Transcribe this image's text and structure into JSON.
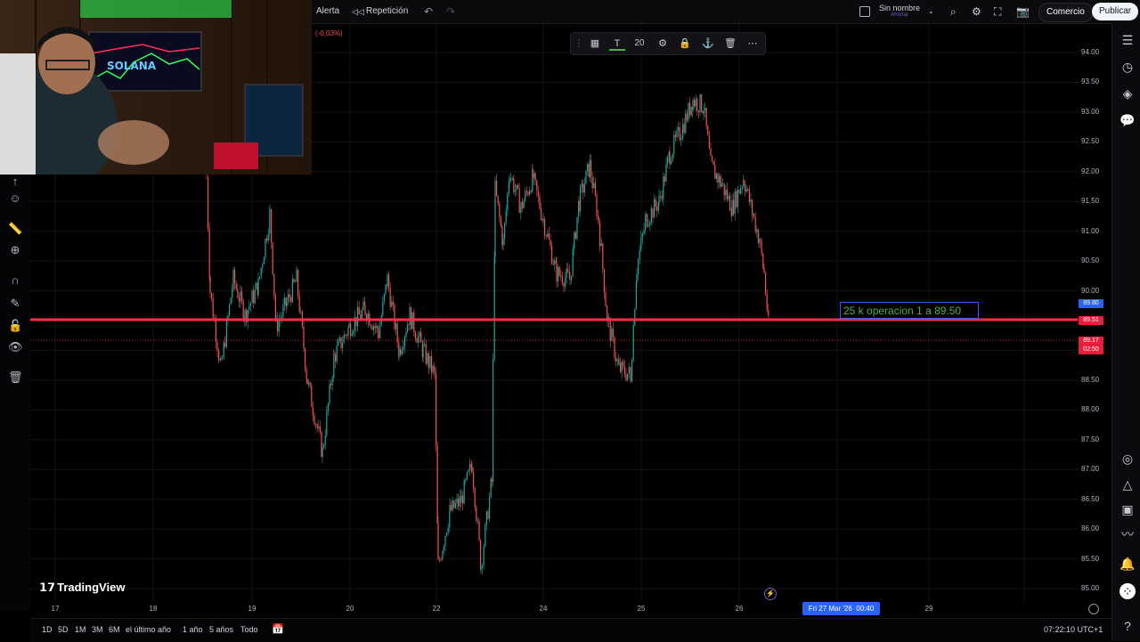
{
  "topbar": {
    "alert_label": "Alerta",
    "replay_label": "Repetición",
    "layout_name": "Sin nombre",
    "layout_status": "Ahorrar",
    "trade_label": "Comercio",
    "publish_label": "Publicar"
  },
  "chart": {
    "change_label": "(-0,03%)",
    "price_ticks": [
      "94.00",
      "93.50",
      "93.00",
      "92.50",
      "92.00",
      "91.50",
      "91.00",
      "90.50",
      "90.00",
      "89.50",
      "89.00",
      "88.50",
      "88.00",
      "87.50",
      "87.00",
      "86.50",
      "86.00",
      "85.50",
      "85.00"
    ],
    "time_ticks": [
      "17",
      "18",
      "19",
      "20",
      "22",
      "24",
      "25",
      "26",
      "29"
    ],
    "labels": {
      "blue": "89.80",
      "red_line": "89.51",
      "last_price": "89.17",
      "countdown": "02:50"
    },
    "annotation": "25 k operacion 1 a 89.50",
    "crosshair_date": "Fri 27 Mar '26",
    "crosshair_time": "00:40",
    "logo_text": "TradingView",
    "colors": {
      "up": "#26a69a",
      "down": "#ef5350",
      "line": "#ff2d48",
      "accent": "#2962ff",
      "annotation_text": "#4caf50"
    }
  },
  "drawing_toolbar": {
    "font_size": "20"
  },
  "bottombar": {
    "ranges": [
      "1D",
      "5D",
      "1M",
      "3M",
      "6M",
      "el último año",
      "1 año",
      "5 años",
      "Todo"
    ],
    "clock": "07:22:10 UTC+1"
  },
  "webcam": {
    "screen_text": "SOLANA"
  },
  "chart_data": {
    "type": "candlestick",
    "y_range": [
      85.0,
      94.0
    ],
    "x_ticks": [
      "17",
      "18",
      "19",
      "20",
      "22",
      "24",
      "25",
      "26",
      "29"
    ],
    "horizontal_line": 89.51,
    "last_price": 89.17
  }
}
